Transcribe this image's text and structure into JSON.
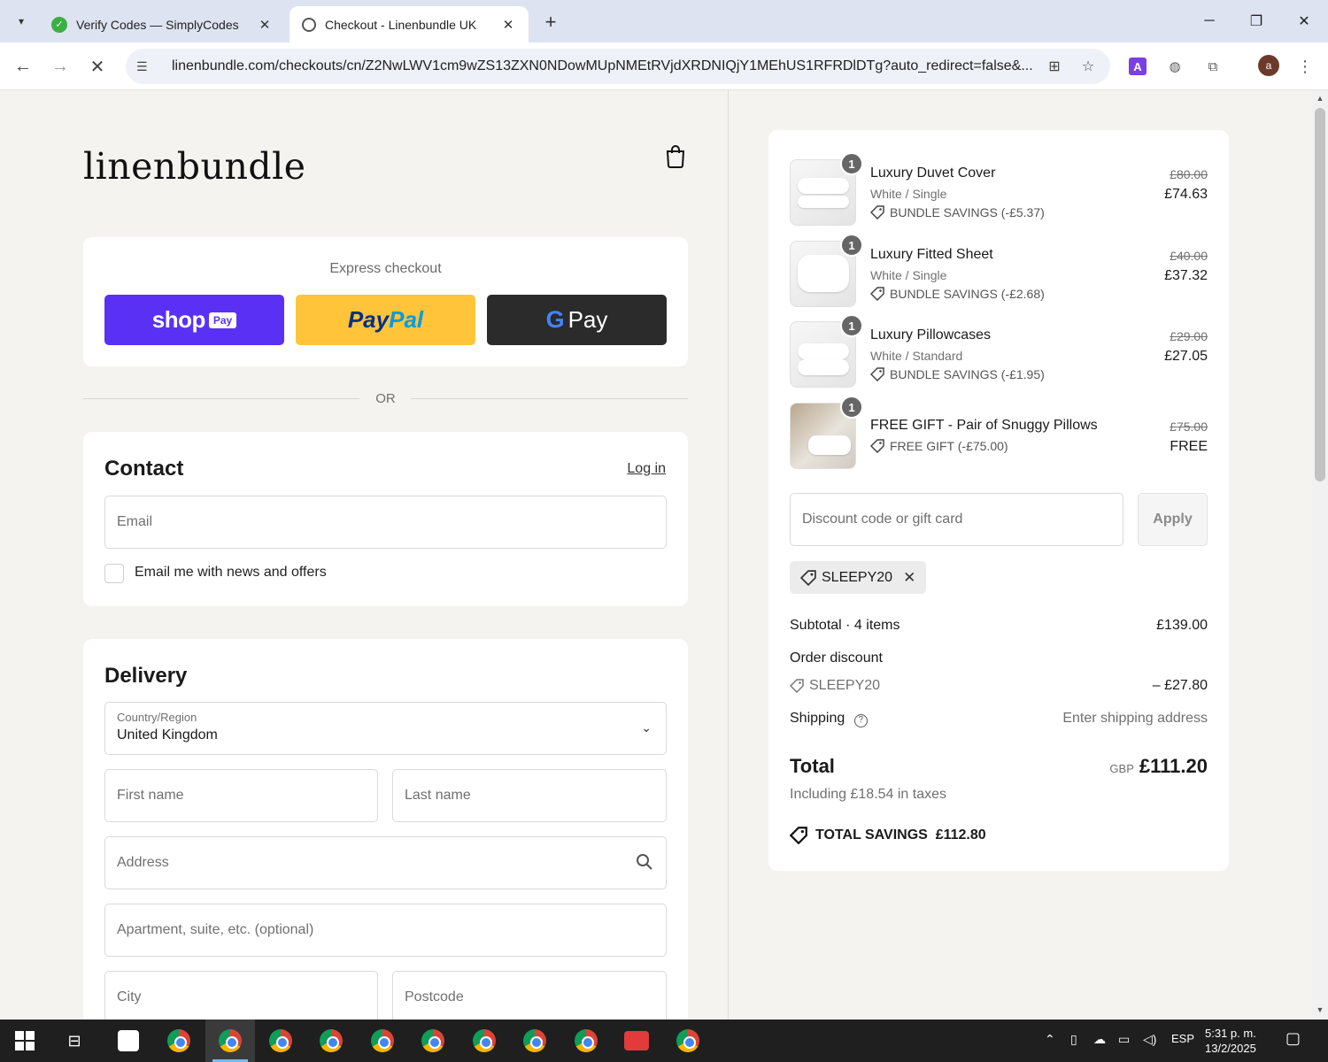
{
  "browser": {
    "tabs": [
      {
        "title": "Verify Codes — SimplyCodes",
        "active": false
      },
      {
        "title": "Checkout - Linenbundle UK",
        "active": true
      }
    ],
    "url": "linenbundle.com/checkouts/cn/Z2NwLWV1cm9wZS13ZXN0NDowMUpNMEtRVjdXRDNIQjY1MEhUS1RFRDlDTg?auto_redirect=false&...",
    "profile_initial": "a"
  },
  "brand": {
    "logo_text": "linenbundle"
  },
  "express": {
    "title": "Express checkout",
    "shop_word": "shop",
    "shop_badge": "Pay",
    "paypal_a": "Pay",
    "paypal_b": "Pal",
    "gpay_g": "G",
    "gpay_pay": "Pay",
    "or_text": "OR"
  },
  "contact": {
    "title": "Contact",
    "login_label": "Log in",
    "email_placeholder": "Email",
    "newsletter_label": "Email me with news and offers"
  },
  "delivery": {
    "title": "Delivery",
    "country_label": "Country/Region",
    "country_value": "United Kingdom",
    "first_name_placeholder": "First name",
    "last_name_placeholder": "Last name",
    "address_placeholder": "Address",
    "apartment_placeholder": "Apartment, suite, etc. (optional)",
    "city_placeholder": "City",
    "postcode_placeholder": "Postcode"
  },
  "summary": {
    "items": [
      {
        "qty": "1",
        "name": "Luxury Duvet Cover",
        "variant": "White / Single",
        "saving": "BUNDLE SAVINGS (-£5.37)",
        "old_price": "£80.00",
        "price": "£74.63"
      },
      {
        "qty": "1",
        "name": "Luxury Fitted Sheet",
        "variant": "White / Single",
        "saving": "BUNDLE SAVINGS (-£2.68)",
        "old_price": "£40.00",
        "price": "£37.32"
      },
      {
        "qty": "1",
        "name": "Luxury Pillowcases",
        "variant": "White / Standard",
        "saving": "BUNDLE SAVINGS (-£1.95)",
        "old_price": "£29.00",
        "price": "£27.05"
      },
      {
        "qty": "1",
        "name": "FREE GIFT - Pair of Snuggy Pillows",
        "variant": "",
        "saving": "FREE GIFT (-£75.00)",
        "old_price": "£75.00",
        "price": "FREE"
      }
    ],
    "discount_placeholder": "Discount code or gift card",
    "apply_label": "Apply",
    "applied_code": "SLEEPY20",
    "subtotal_label": "Subtotal · 4 items",
    "subtotal_value": "£139.00",
    "order_discount_label": "Order discount",
    "order_discount_code": "SLEEPY20",
    "order_discount_value": "– £27.80",
    "shipping_label": "Shipping",
    "shipping_value": "Enter shipping address",
    "total_label": "Total",
    "currency": "GBP",
    "total_value": "£111.20",
    "taxes_note": "Including £18.54 in taxes",
    "total_savings": "TOTAL SAVINGS  £112.80"
  },
  "taskbar": {
    "language": "ESP",
    "time": "5:31 p. m.",
    "date": "13/2/2025"
  }
}
